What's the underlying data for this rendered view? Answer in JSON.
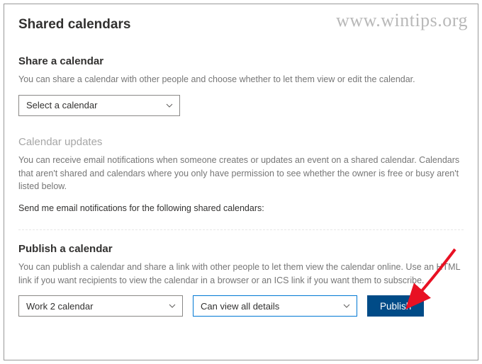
{
  "watermark": "www.wintips.org",
  "page_title": "Shared calendars",
  "share": {
    "title": "Share a calendar",
    "desc": "You can share a calendar with other people and choose whether to let them view or edit the calendar.",
    "dropdown_value": "Select a calendar"
  },
  "updates": {
    "title": "Calendar updates",
    "desc": "You can receive email notifications when someone creates or updates an event on a shared calendar. Calendars that aren't shared and calendars where you only have permission to see whether the owner is free or busy aren't listed below.",
    "prompt": "Send me email notifications for the following shared calendars:"
  },
  "publish": {
    "title": "Publish a calendar",
    "desc": "You can publish a calendar and share a link with other people to let them view the calendar online. Use an HTML link if you want recipients to view the calendar in a browser or an ICS link if you want them to subscribe.",
    "calendar_value": "Work 2 calendar",
    "permission_value": "Can view all details",
    "button_label": "Publish"
  }
}
